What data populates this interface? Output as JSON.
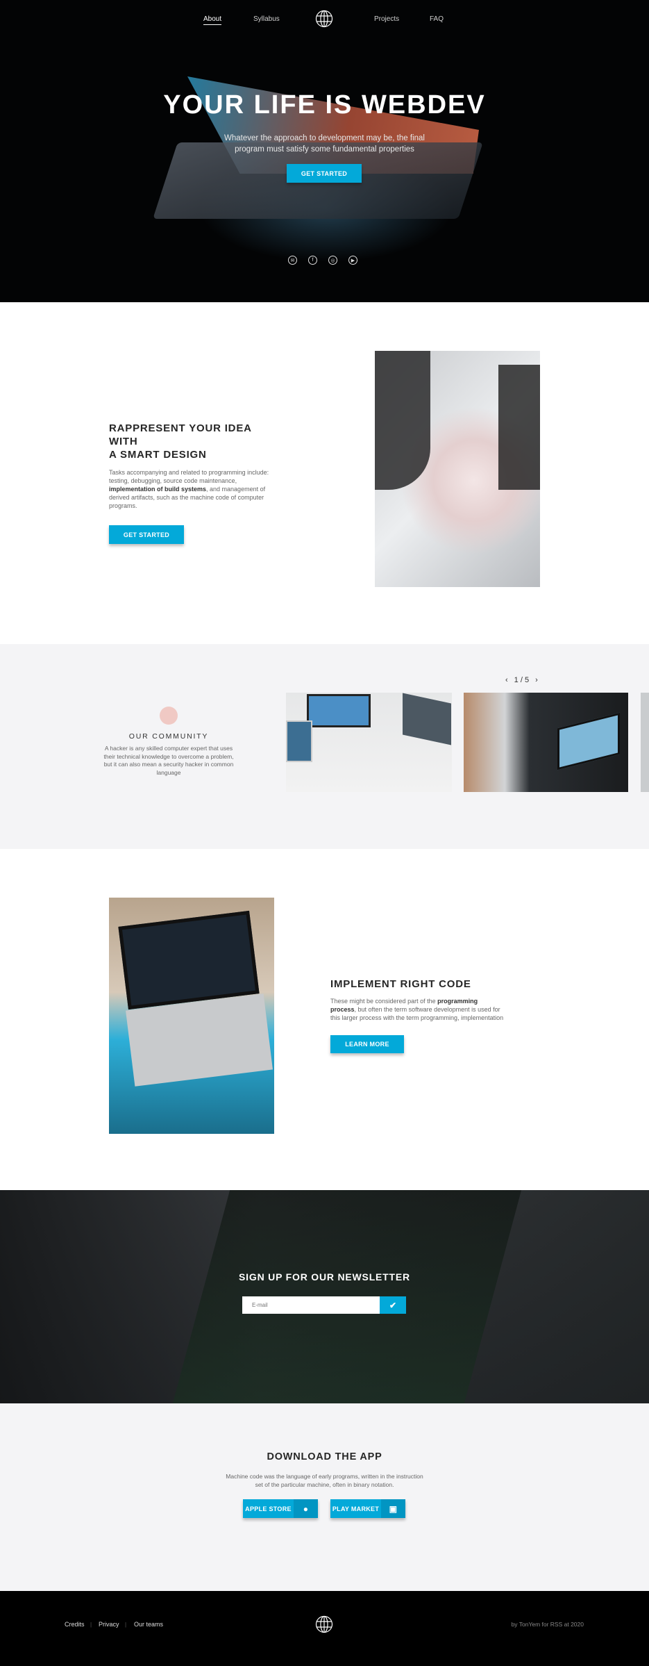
{
  "nav": {
    "items": [
      {
        "label": "About",
        "active": true
      },
      {
        "label": "Syllabus"
      },
      {
        "label": "Projects"
      },
      {
        "label": "FAQ"
      }
    ],
    "logo_icon": "globe-icon"
  },
  "hero": {
    "title": "YOUR LIFE IS WEBDEV",
    "subtitle_line1": "Whatever the approach to development may be, the final",
    "subtitle_line2": "program must satisfy some fundamental properties",
    "button": "GET STARTED",
    "social_icons": [
      "mail-icon",
      "facebook-icon",
      "instagram-icon",
      "youtube-icon"
    ]
  },
  "idea": {
    "title_line1": "RAPPRESENT YOUR IDEA WITH",
    "title_line2": "A SMART DESIGN",
    "text_before": "Tasks accompanying and related to programming include: testing, debugging, source code maintenance, ",
    "text_bold": "implementation of build systems",
    "text_after": ", and management of derived artifacts, such as the machine code of computer programs.",
    "button": "GET STARTED"
  },
  "community": {
    "title": "OUR COMMUNITY",
    "text": "A hacker is any skilled computer expert that uses their technical knowledge to overcome a problem, but it can also mean a security hacker in common language",
    "slider": {
      "counter": "1 / 5",
      "current": 1,
      "total": 5
    }
  },
  "code": {
    "title": "IMPLEMENT RIGHT CODE",
    "text_before": "These might be considered part of the ",
    "text_bold": "programming process",
    "text_after": ", but often the term software development is used for this larger process with the term programming, implementation",
    "button": "LEARN MORE"
  },
  "newsletter": {
    "title": "SIGN UP FOR OUR NEWSLETTER",
    "placeholder": "E-mail",
    "submit_icon": "check-icon"
  },
  "download": {
    "title": "DOWNLOAD THE APP",
    "text_line1": "Machine code was the language of early programs, written in the instruction",
    "text_line2": "set of the particular machine, often in binary notation.",
    "apple": "APPLE STORE",
    "play": "PLAY MARKET"
  },
  "footer": {
    "links": [
      "Credits",
      "Privacy",
      "Our teams"
    ],
    "credit": "by TonYem for RSS at 2020"
  },
  "colors": {
    "accent": "#03a9d9",
    "dark": "#000000",
    "light_bg": "#f4f4f6"
  }
}
